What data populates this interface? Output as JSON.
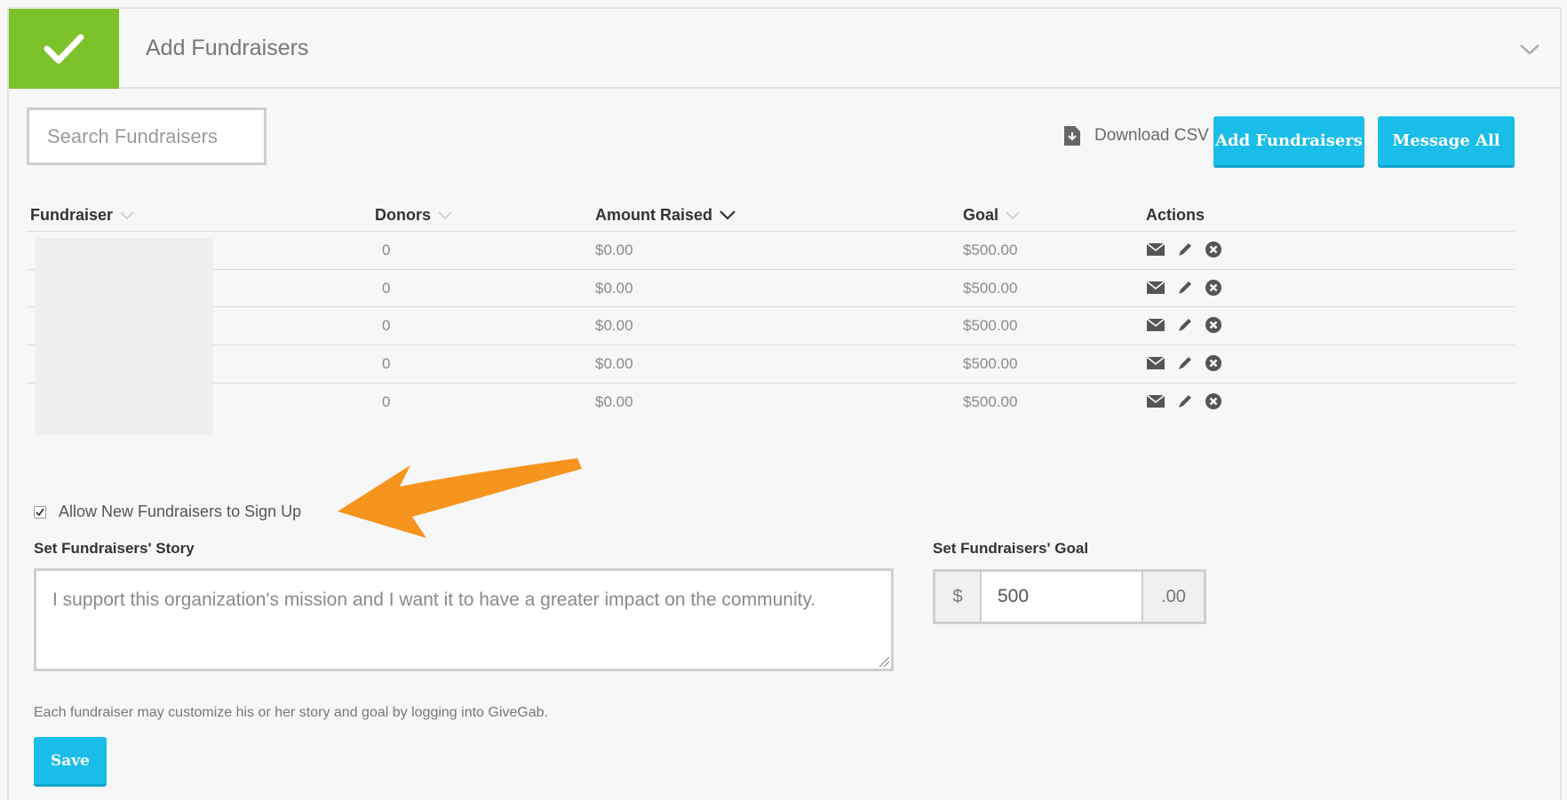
{
  "header": {
    "title": "Add Fundraisers",
    "status_color": "#7cc22a"
  },
  "toolbar": {
    "search_placeholder": "Search Fundraisers",
    "download_label": "Download CSV",
    "add_label": "Add Fundraisers",
    "message_label": "Message All"
  },
  "table": {
    "columns": [
      "Fundraiser",
      "Donors",
      "Amount Raised",
      "Goal",
      "Actions"
    ],
    "rows": [
      {
        "donors": "0",
        "amount": "$0.00",
        "goal": "$500.00"
      },
      {
        "donors": "0",
        "amount": "$0.00",
        "goal": "$500.00"
      },
      {
        "donors": "0",
        "amount": "$0.00",
        "goal": "$500.00"
      },
      {
        "donors": "0",
        "amount": "$0.00",
        "goal": "$500.00"
      },
      {
        "donors": "0",
        "amount": "$0.00",
        "goal": "$500.00"
      }
    ]
  },
  "settings": {
    "allow_signup_label": "Allow New Fundraisers to Sign Up",
    "allow_signup_checked": true,
    "story_label": "Set Fundraisers' Story",
    "story_value": "I support this organization's mission and I want it to have a greater impact on the community.",
    "goal_label": "Set Fundraisers' Goal",
    "goal_prefix": "$",
    "goal_value": "500",
    "goal_suffix": ".00",
    "note": "Each fundraiser may customize his or her story and goal by logging into GiveGab.",
    "save_label": "Save"
  },
  "colors": {
    "accent": "#19bde8",
    "arrow": "#f7941d"
  }
}
